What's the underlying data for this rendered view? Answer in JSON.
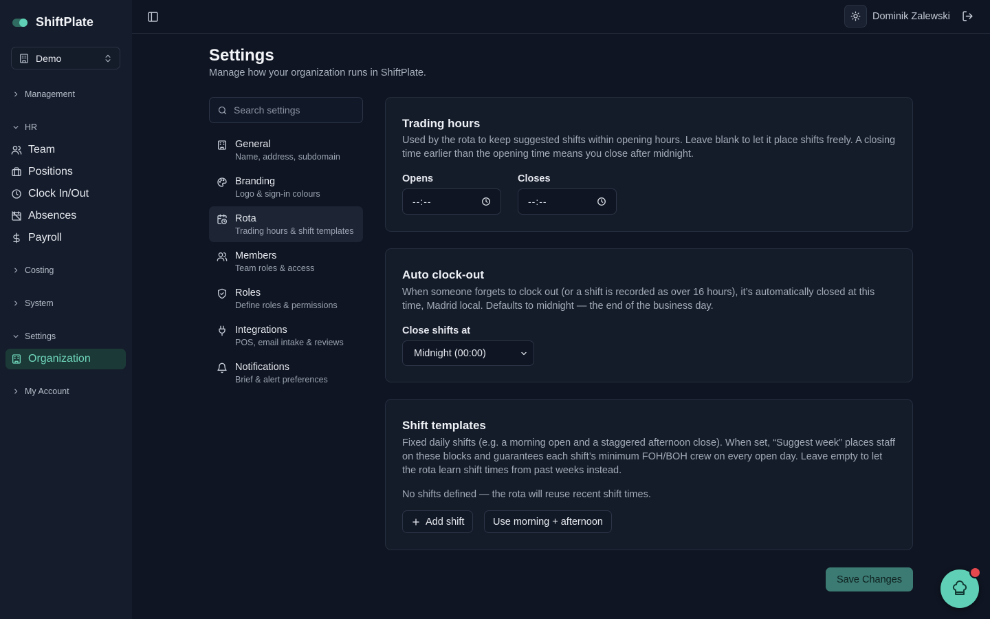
{
  "brand": {
    "name": "ShiftPlate"
  },
  "org_selector": {
    "value": "Demo"
  },
  "sidebar": {
    "groups": {
      "management": "Management",
      "hr": "HR",
      "costing": "Costing",
      "system": "System",
      "settings": "Settings",
      "my_account": "My Account"
    },
    "hr_items": [
      "Team",
      "Positions",
      "Clock In/Out",
      "Absences",
      "Payroll"
    ],
    "settings_items": [
      "Organization"
    ],
    "active": "Organization"
  },
  "topbar": {
    "user_name": "Dominik Zalewski"
  },
  "page": {
    "title": "Settings",
    "subtitle": "Manage how your organization runs in ShiftPlate."
  },
  "search": {
    "placeholder": "Search settings"
  },
  "settings_nav": [
    {
      "title": "General",
      "desc": "Name, address, subdomain",
      "icon": "building-icon"
    },
    {
      "title": "Branding",
      "desc": "Logo & sign-in colours",
      "icon": "palette-icon"
    },
    {
      "title": "Rota",
      "desc": "Trading hours & shift templates",
      "icon": "calendar-clock-icon",
      "active": true
    },
    {
      "title": "Members",
      "desc": "Team roles & access",
      "icon": "users-icon"
    },
    {
      "title": "Roles",
      "desc": "Define roles & permissions",
      "icon": "shield-icon"
    },
    {
      "title": "Integrations",
      "desc": "POS, email intake & reviews",
      "icon": "plug-icon"
    },
    {
      "title": "Notifications",
      "desc": "Brief & alert preferences",
      "icon": "bell-icon"
    }
  ],
  "trading_hours": {
    "title": "Trading hours",
    "desc": "Used by the rota to keep suggested shifts within opening hours. Leave blank to let it place shifts freely. A closing time earlier than the opening time means you close after midnight.",
    "opens_label": "Opens",
    "opens_value": "--:--",
    "closes_label": "Closes",
    "closes_value": "--:--"
  },
  "auto_clockout": {
    "title": "Auto clock-out",
    "desc": "When someone forgets to clock out (or a shift is recorded as over 16 hours), it’s automatically closed at this time, Madrid local. Defaults to midnight — the end of the business day.",
    "field_label": "Close shifts at",
    "selected": "Midnight (00:00)"
  },
  "shift_templates": {
    "title": "Shift templates",
    "desc": "Fixed daily shifts (e.g. a morning open and a staggered afternoon close). When set, “Suggest week” places staff on these blocks and guarantees each shift’s minimum FOH/BOH crew on every open day. Leave empty to let the rota learn shift times from past weeks instead.",
    "empty_note": "No shifts defined — the rota will reuse recent shift times.",
    "add_label": "Add shift",
    "preset_label": "Use morning + afternoon"
  },
  "actions": {
    "save_label": "Save Changes"
  },
  "colors": {
    "accent": "#5fd0b5",
    "background": "#0f1522",
    "badge": "#e5484d"
  }
}
